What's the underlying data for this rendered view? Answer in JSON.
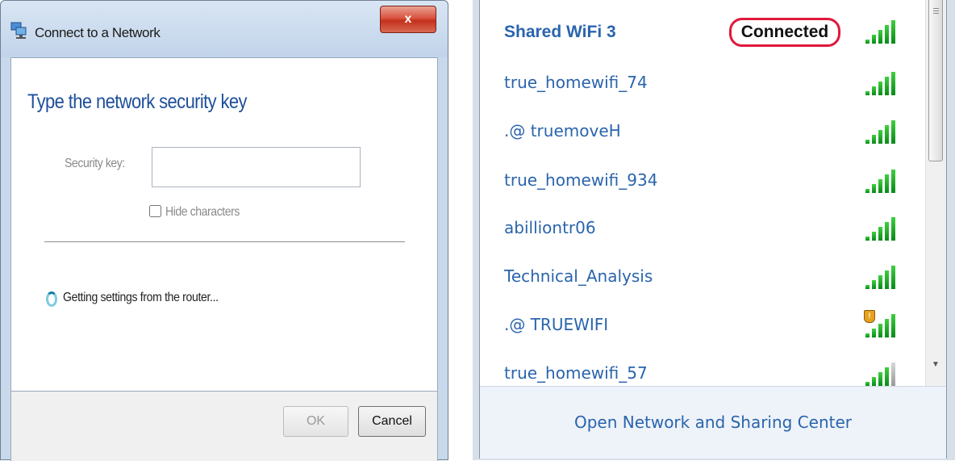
{
  "dialog": {
    "title": "Connect to a Network",
    "close_label": "x",
    "heading": "Type the network security key",
    "security_key_label": "Security key:",
    "security_key_value": "",
    "hide_characters_label": "Hide characters",
    "hide_characters_checked": false,
    "status_text": "Getting settings from the router...",
    "ok_label": "OK",
    "cancel_label": "Cancel"
  },
  "flyout": {
    "networks": [
      {
        "name": "Shared WiFi 3",
        "status": "Connected",
        "signal_bars": 5,
        "secured": false
      },
      {
        "name": "true_homewifi_74",
        "signal_bars": 5,
        "secured": false
      },
      {
        "name": ".@  truemoveH",
        "signal_bars": 5,
        "secured": false
      },
      {
        "name": "true_homewifi_934",
        "signal_bars": 5,
        "secured": false
      },
      {
        "name": "abilliontr06",
        "signal_bars": 5,
        "secured": false
      },
      {
        "name": "Technical_Analysis",
        "signal_bars": 5,
        "secured": false
      },
      {
        "name": ".@  TRUEWIFI",
        "signal_bars": 5,
        "secured": true
      },
      {
        "name": "true_homewifi_57",
        "signal_bars": 4,
        "secured": false
      }
    ],
    "footer_link": "Open Network and Sharing Center"
  },
  "colors": {
    "link_blue": "#2a64ad",
    "heading_blue": "#1e4f9c",
    "connected_outline": "#e0183a",
    "signal_green": "#0a8a1a"
  },
  "icons": {
    "dialog_app": "network-monitor-icon",
    "close": "close-icon",
    "spinner": "loading-spinner-icon",
    "signal": "wifi-signal-bars-icon",
    "shield": "security-shield-icon"
  }
}
